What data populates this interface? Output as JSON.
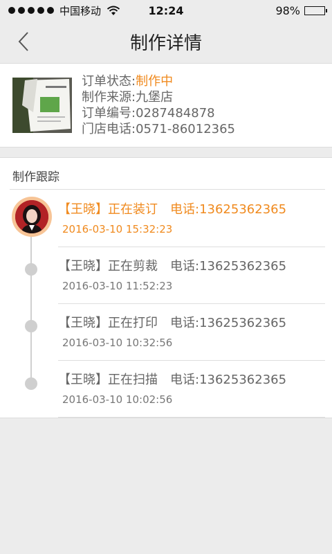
{
  "status_bar": {
    "carrier": "中国移动",
    "time": "12:24",
    "battery": "98%",
    "battery_level": 0.98
  },
  "nav": {
    "title": "制作详情"
  },
  "order": {
    "status_label": "订单状态:",
    "status_value": "制作中",
    "source_label": "制作来源:",
    "source_value": "九堡店",
    "number_label": "订单编号:",
    "number_value": "0287484878",
    "phone_label": "门店电话:",
    "phone_value": "0571-86012365"
  },
  "tracking": {
    "header": "制作跟踪",
    "items": [
      {
        "who": "【王晓】",
        "action": "正在装订",
        "phone_label": "电话:",
        "phone": "13625362365",
        "time": "2016-03-10   15:32:23",
        "active": true
      },
      {
        "who": "【王晓】",
        "action": "正在剪裁",
        "phone_label": "电话:",
        "phone": "13625362365",
        "time": "2016-03-10   11:52:23",
        "active": false
      },
      {
        "who": "【王晓】",
        "action": "正在打印",
        "phone_label": "电话:",
        "phone": "13625362365",
        "time": "2016-03-10   10:32:56",
        "active": false
      },
      {
        "who": "【王晓】",
        "action": "正在扫描",
        "phone_label": "电话:",
        "phone": "13625362365",
        "time": "2016-03-10   10:02:56",
        "active": false
      }
    ]
  },
  "colors": {
    "accent": "#f08a1e",
    "background": "#ececec",
    "node": "#cfcfcf"
  }
}
